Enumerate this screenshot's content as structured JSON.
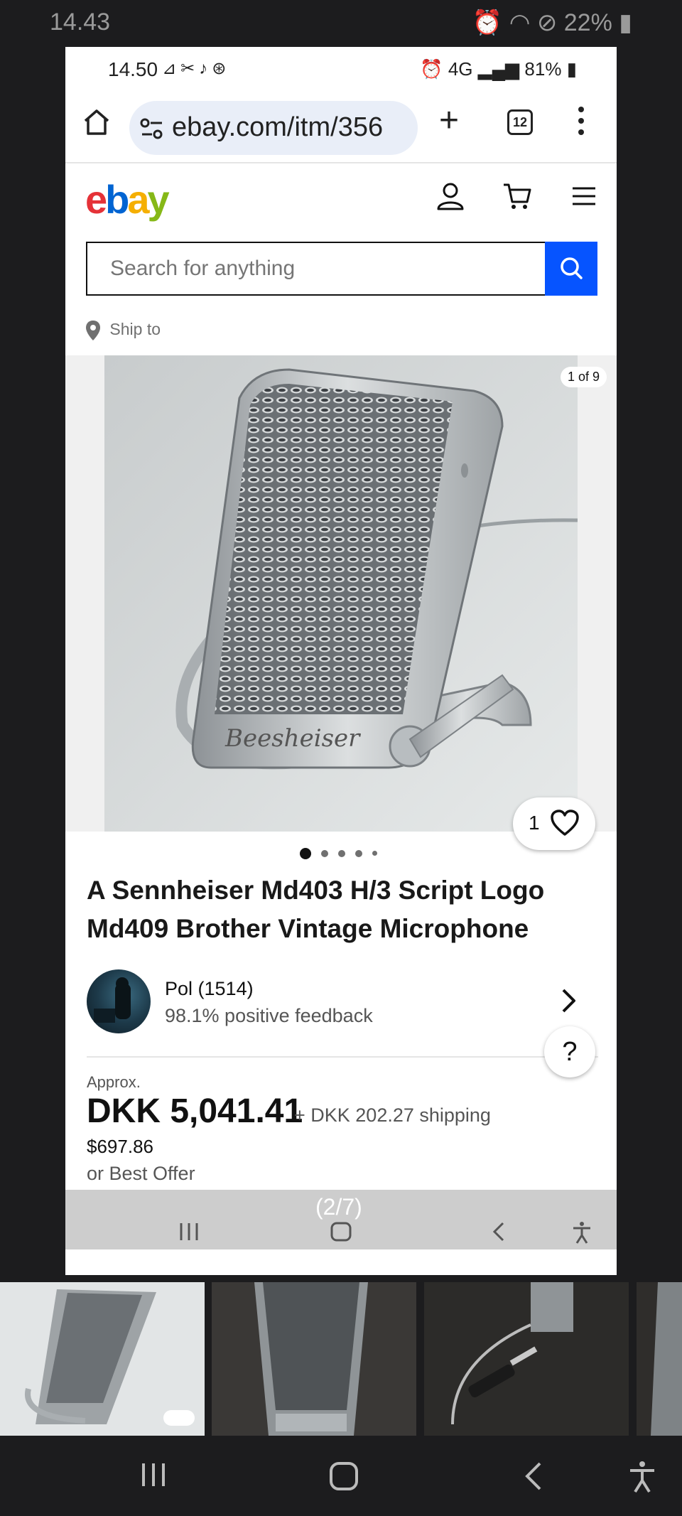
{
  "outer_status": {
    "time": "14.43",
    "battery": "22%"
  },
  "inner_status": {
    "time": "14.50",
    "network": "4G",
    "battery": "81%"
  },
  "browser": {
    "url": "ebay.com/itm/356",
    "tab_count": "12"
  },
  "search": {
    "placeholder": "Search for anything"
  },
  "ship_to": "Ship to",
  "gallery": {
    "counter": "1 of 9",
    "watch_count": "1"
  },
  "listing": {
    "title": "A Sennheiser Md403 H/3 Script Logo Md409 Brother Vintage Microphone",
    "seller_name": "Pol (1514)",
    "seller_feedback": "98.1% positive feedback",
    "approx_label": "Approx.",
    "price": "DKK 5,041.41",
    "shipping": "+ DKK 202.27 shipping",
    "usd_price": "$697.86",
    "best_offer": "or Best Offer"
  },
  "help_label": "?",
  "page_indicator": "(2/7)",
  "colors": {
    "ebay_blue": "#0654ff",
    "logo_red": "#e53238",
    "logo_blue": "#0064d2",
    "logo_yellow": "#f5af02",
    "logo_green": "#86b817"
  }
}
